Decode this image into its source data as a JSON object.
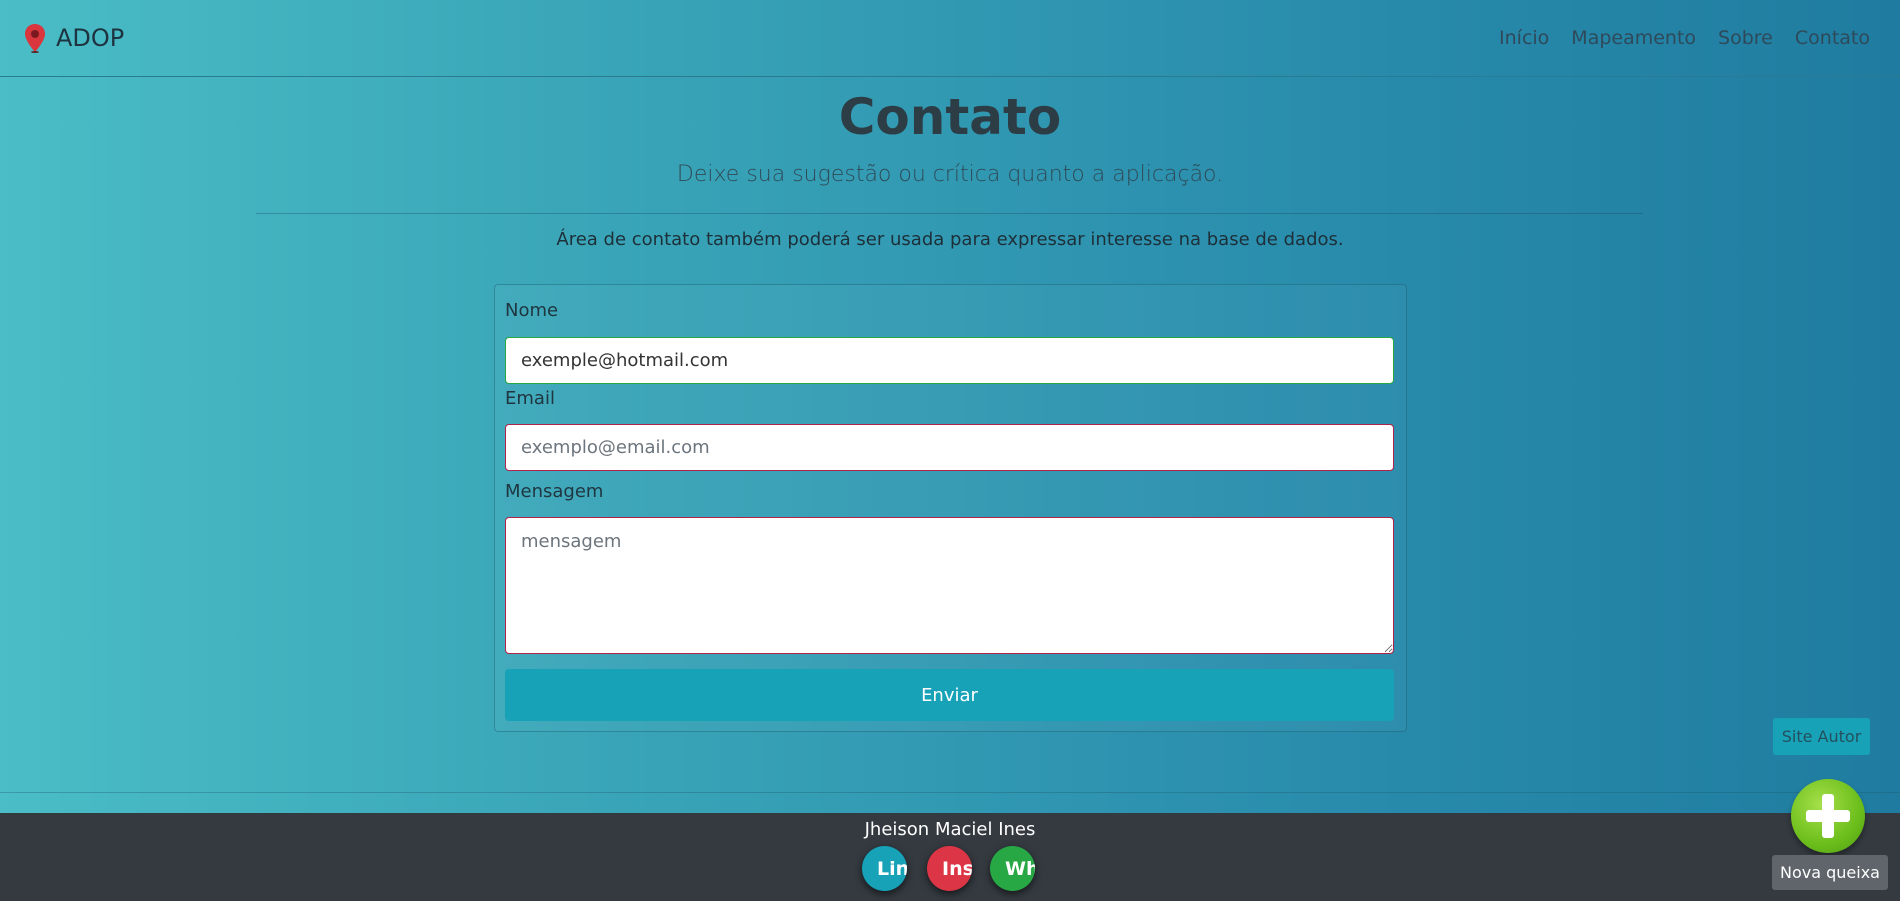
{
  "navbar": {
    "brand": "ADOP",
    "brand_icon": "map-pin-icon",
    "links": [
      "Início",
      "Mapeamento",
      "Sobre",
      "Contato"
    ]
  },
  "header": {
    "title": "Contato",
    "lead": "Deixe sua sugestão ou crítica quanto a aplicação.",
    "note": "Área de contato também poderá ser usada para expressar interesse na base de dados."
  },
  "form": {
    "name_label": "Nome",
    "name_value": "exemple@hotmail.com",
    "email_label": "Email",
    "email_placeholder": "exemplo@email.com",
    "message_label": "Mensagem",
    "message_placeholder": "mensagem",
    "submit_label": "Enviar"
  },
  "site_autor_label": "Site Autor",
  "footer": {
    "author": "Jheison Maciel Ines",
    "social": [
      {
        "label": "Linkedin",
        "color": "#17a2b8"
      },
      {
        "label": "Instagram",
        "color": "#dc3545"
      },
      {
        "label": "WhatsApp",
        "color": "#28a745"
      }
    ]
  },
  "fab": {
    "icon": "plus-icon",
    "label": "Nova queixa"
  },
  "colors": {
    "accent": "#17a2b8",
    "valid": "#28a745",
    "invalid": "#b0234a",
    "footer_bg": "#343a40"
  }
}
